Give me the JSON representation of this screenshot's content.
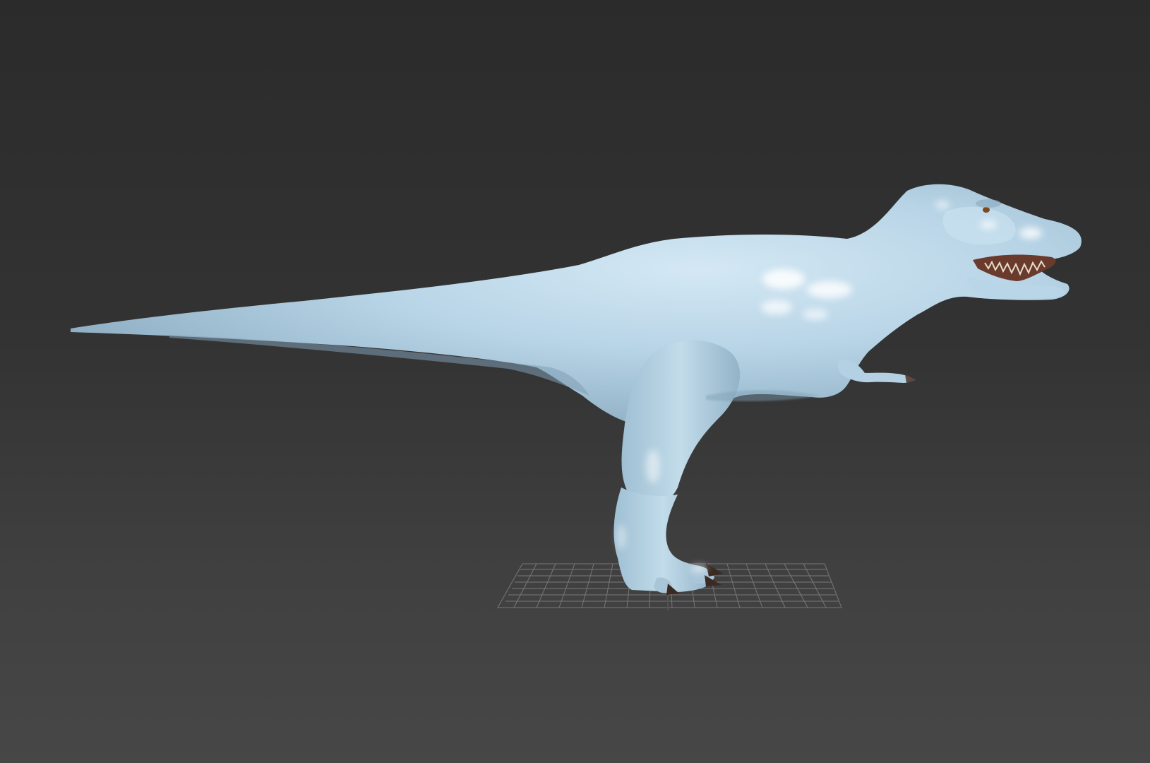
{
  "viewport": {
    "background_top": "#2b2b2b",
    "background_bottom": "#474747",
    "model_color": "#b7d4e6",
    "model_shadow": "#7f9fb4",
    "model_highlight": "#ffffff",
    "grid_color": "#8a8a8a",
    "claw_color": "#3a2a22",
    "mouth_color": "#6a3a2c",
    "eye_color": "#7a4a20"
  }
}
